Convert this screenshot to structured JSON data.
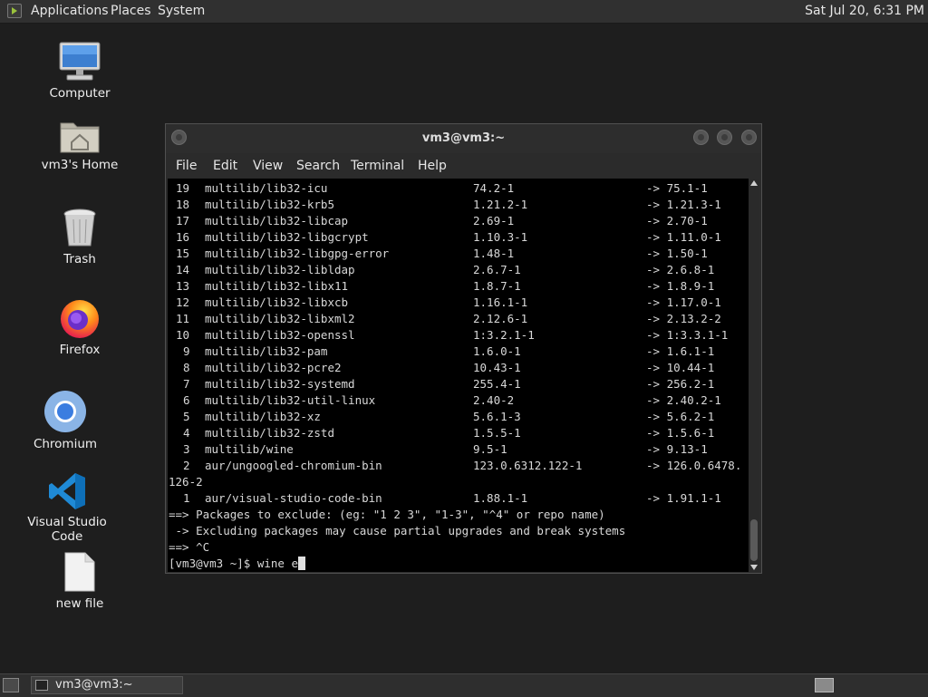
{
  "top_panel": {
    "menus": [
      "Applications",
      "Places",
      "System"
    ],
    "clock": "Sat Jul 20,  6:31 PM"
  },
  "desktop": {
    "icons": [
      {
        "label": "Computer",
        "icon": "computer-icon"
      },
      {
        "label": "vm3's Home",
        "icon": "home-folder-icon"
      },
      {
        "label": "Trash",
        "icon": "trash-icon"
      },
      {
        "label": "Firefox",
        "icon": "firefox-icon"
      },
      {
        "label": "Chromium",
        "icon": "chromium-icon"
      },
      {
        "label": "Visual Studio Code",
        "icon": "vscode-icon"
      },
      {
        "label": "new file",
        "icon": "file-icon"
      }
    ]
  },
  "terminal": {
    "title": "vm3@vm3:~",
    "menu": [
      "File",
      "Edit",
      "View",
      "Search",
      "Terminal",
      "Help"
    ],
    "packages": [
      {
        "num": "19",
        "name": "multilib/lib32-icu",
        "old": "74.2-1",
        "new": "-> 75.1-1"
      },
      {
        "num": "18",
        "name": "multilib/lib32-krb5",
        "old": "1.21.2-1",
        "new": "-> 1.21.3-1"
      },
      {
        "num": "17",
        "name": "multilib/lib32-libcap",
        "old": "2.69-1",
        "new": "-> 2.70-1"
      },
      {
        "num": "16",
        "name": "multilib/lib32-libgcrypt",
        "old": "1.10.3-1",
        "new": "-> 1.11.0-1"
      },
      {
        "num": "15",
        "name": "multilib/lib32-libgpg-error",
        "old": "1.48-1",
        "new": "-> 1.50-1"
      },
      {
        "num": "14",
        "name": "multilib/lib32-libldap",
        "old": "2.6.7-1",
        "new": "-> 2.6.8-1"
      },
      {
        "num": "13",
        "name": "multilib/lib32-libx11",
        "old": "1.8.7-1",
        "new": "-> 1.8.9-1"
      },
      {
        "num": "12",
        "name": "multilib/lib32-libxcb",
        "old": "1.16.1-1",
        "new": "-> 1.17.0-1"
      },
      {
        "num": "11",
        "name": "multilib/lib32-libxml2",
        "old": "2.12.6-1",
        "new": "-> 2.13.2-2"
      },
      {
        "num": "10",
        "name": "multilib/lib32-openssl",
        "old": "1:3.2.1-1",
        "new": "-> 1:3.3.1-1"
      },
      {
        "num": "9",
        "name": "multilib/lib32-pam",
        "old": "1.6.0-1",
        "new": "-> 1.6.1-1"
      },
      {
        "num": "8",
        "name": "multilib/lib32-pcre2",
        "old": "10.43-1",
        "new": "-> 10.44-1"
      },
      {
        "num": "7",
        "name": "multilib/lib32-systemd",
        "old": "255.4-1",
        "new": "-> 256.2-1"
      },
      {
        "num": "6",
        "name": "multilib/lib32-util-linux",
        "old": "2.40-2",
        "new": "-> 2.40.2-1"
      },
      {
        "num": "5",
        "name": "multilib/lib32-xz",
        "old": "5.6.1-3",
        "new": "-> 5.6.2-1"
      },
      {
        "num": "4",
        "name": "multilib/lib32-zstd",
        "old": "1.5.5-1",
        "new": "-> 1.5.6-1"
      },
      {
        "num": "3",
        "name": "multilib/wine",
        "old": "9.5-1",
        "new": "-> 9.13-1"
      },
      {
        "num": "2",
        "name": "aur/ungoogled-chromium-bin",
        "old": "123.0.6312.122-1",
        "new": "-> 126.0.6478."
      },
      {
        "num": "",
        "name": "126-2",
        "old": "",
        "new": "",
        "wrap": true
      },
      {
        "num": "1",
        "name": "aur/visual-studio-code-bin",
        "old": "1.88.1-1",
        "new": "-> 1.91.1-1"
      }
    ],
    "messages": [
      "==> Packages to exclude: (eg: \"1 2 3\", \"1-3\", \"^4\" or repo name)",
      " -> Excluding packages may cause partial upgrades and break systems",
      "==> ^C"
    ],
    "prompt": "[vm3@vm3 ~]$ ",
    "command": "wine e"
  },
  "taskbar": {
    "task_label": "vm3@vm3:~"
  }
}
